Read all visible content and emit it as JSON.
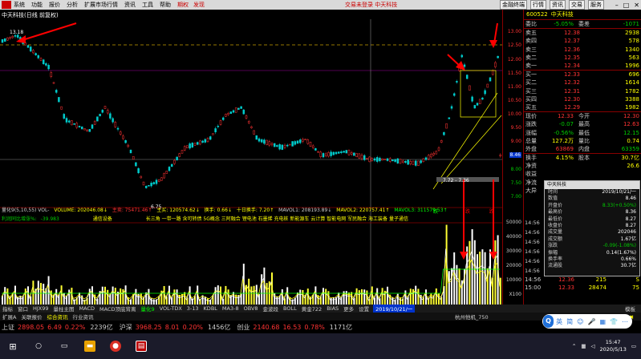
{
  "menubar": {
    "items": [
      "系统",
      "功能",
      "报价",
      "分析",
      "扩展市场行情",
      "资讯",
      "工具",
      "帮助"
    ],
    "red_items": [
      "期权",
      "发现"
    ],
    "center_text": "交易未登录  中天科技",
    "right_buttons": [
      "金融终端",
      "行情",
      "资讯",
      "交易",
      "服务"
    ]
  },
  "chart": {
    "title": "中天科技(日线 前复权)",
    "high_label": "13.18",
    "low_label": "6.75",
    "trend_label": "7.72 - 7.36",
    "axis_labels": [
      "13.00",
      "12.50",
      "12.00",
      "11.50",
      "11.00",
      "10.50",
      "10.00",
      "9.50",
      "9.00",
      "8.50",
      "8.00",
      "7.50",
      "7.00"
    ],
    "current_price_tag": "8.46",
    "vol_axis_labels": [
      "50000",
      "40000",
      "30000",
      "20000",
      "10000",
      "X100"
    ],
    "volume_header": {
      "name": "量化9(5,10,55) VOL-",
      "items": [
        "VOLUME: 202046.08↓",
        "主卖: 75471.46↑",
        "主买: 120574.62↓",
        "换手: 0.66↓",
        "十日换手: 7.20↑",
        "MAVOL1: 208193.89↓",
        "MAVOL2: 220757.41↑",
        "MAVOL3: 311579.53↑"
      ]
    },
    "concept_row": {
      "left": "利润同比增涨%:",
      "left_val": "-39.983",
      "industry": "通信设备",
      "concepts": "长三角 一带一路 含可转债 5G概念 三阿融合 锂电池 石墨烯 充电桩 新能源车 云计算 智能电网 军民融合 海工装备 量子通信"
    },
    "markers": [
      "跌",
      "跌",
      "跌",
      "跌"
    ],
    "date_label": "2019/10/21/一"
  },
  "quote": {
    "code": "600522",
    "name": "中天科技",
    "ratio_row": {
      "l": "委比",
      "a": "-5.05%",
      "l2": "委差",
      "b": "-1071"
    },
    "asks": [
      {
        "l": "卖五",
        "p": "12.38",
        "v": "2938"
      },
      {
        "l": "卖四",
        "p": "12.37",
        "v": "578"
      },
      {
        "l": "卖三",
        "p": "12.36",
        "v": "1340"
      },
      {
        "l": "卖二",
        "p": "12.35",
        "v": "563"
      },
      {
        "l": "卖一",
        "p": "12.34",
        "v": "1996"
      }
    ],
    "bids": [
      {
        "l": "买一",
        "p": "12.33",
        "v": "696"
      },
      {
        "l": "买二",
        "p": "12.32",
        "v": "1614"
      },
      {
        "l": "买三",
        "p": "12.31",
        "v": "1782"
      },
      {
        "l": "买四",
        "p": "12.30",
        "v": "3388"
      },
      {
        "l": "买五",
        "p": "12.29",
        "v": "1982"
      }
    ],
    "stats": [
      {
        "l": "现价",
        "a": "12.33",
        "l2": "今开",
        "b": "12.30"
      },
      {
        "l": "涨跌",
        "a": "-0.07",
        "l2": "最高",
        "b": "12.63"
      },
      {
        "l": "涨幅",
        "a": "-0.56%",
        "l2": "最低",
        "b": "12.15"
      },
      {
        "l": "总量",
        "a": "127.2万",
        "l2": "量比",
        "b": "0.74"
      },
      {
        "l": "外盘",
        "a": "63869",
        "l2": "内盘",
        "b": "63359"
      },
      {
        "l": "换手",
        "a": "4.15%",
        "l2": "股本",
        "b": "30.7亿"
      },
      {
        "l": "净资",
        "a": "",
        "l2": "",
        "b": "26.6"
      },
      {
        "l": "收益",
        "a": "",
        "l2": "",
        "b": ""
      },
      {
        "l": "净流",
        "a": "",
        "l2": "",
        "b": ""
      },
      {
        "l": "大异",
        "a": "",
        "l2": "",
        "b": ""
      }
    ],
    "ticks": [
      "14:56",
      "14:56",
      "14:56",
      "14:56",
      "14:56",
      "14:56",
      "14:56"
    ],
    "bottom_rows": [
      {
        "t": "14:56",
        "p": "12.36",
        "v": "215",
        "s": "S"
      },
      {
        "t": "15:00",
        "p": "12.33",
        "v": "28474",
        "s": "75"
      }
    ]
  },
  "popup": {
    "title": "中天科技",
    "rows": [
      {
        "k": "时间",
        "v": "2019/10/21/一",
        "c": ""
      },
      {
        "k": "数值",
        "v": "8.46",
        "c": ""
      },
      {
        "k": "开盘价",
        "v": "8.33(+0.50%)",
        "c": "g"
      },
      {
        "k": "最高价",
        "v": "8.36",
        "c": ""
      },
      {
        "k": "最低价",
        "v": "8.27",
        "c": ""
      },
      {
        "k": "收盘价",
        "v": "8.27",
        "c": ""
      },
      {
        "k": "成交量",
        "v": "202046",
        "c": ""
      },
      {
        "k": "成交额",
        "v": "1.67亿",
        "c": ""
      },
      {
        "k": "涨跌",
        "v": "-0.09(-1.08%)",
        "c": "g"
      },
      {
        "k": "振幅",
        "v": "0.14(1.67%)",
        "c": ""
      },
      {
        "k": "换手率",
        "v": "0.66%",
        "c": ""
      },
      {
        "k": "流通股",
        "v": "30.7亿",
        "c": ""
      }
    ]
  },
  "ind_tabs": {
    "items": [
      "指标",
      "窗口",
      "HJX99",
      "量柱主图",
      "MACD",
      "MACD顶底背离",
      "量化9",
      "VOL-TDX",
      "3-13",
      "KDBL",
      "MA3-8",
      "OBV8",
      "金波段",
      "BOLL",
      "黄金722",
      "BIAS",
      "更多",
      "设置"
    ],
    "active": "量化9",
    "date": "2019/10/21/一",
    "right": "模板"
  },
  "sub_row": {
    "items": [
      "扩展A",
      "关联报价",
      "综合资讯",
      "行业资讯"
    ],
    "selected": "综合资讯",
    "live": "杭州他机_750",
    "right": "到边栏 ✖"
  },
  "index_strip": [
    {
      "name": "上证",
      "v": "2898.05",
      "c": "6.49",
      "p": "0.22%",
      "amt": "2239亿"
    },
    {
      "name": "沪深",
      "v": "3968.25",
      "c": "8.01",
      "p": "0.20%",
      "amt": "1456亿"
    },
    {
      "name": "创业",
      "v": "2140.68",
      "c": "16.53",
      "p": "0.78%",
      "amt": "1171亿"
    }
  ],
  "ime": {
    "items": [
      "英",
      "简",
      "☺",
      "🎤",
      "▦",
      "👕",
      "⋯"
    ]
  },
  "taskbar": {
    "time": "15:47",
    "date": "2020/5/13"
  },
  "colors": {
    "up": "#ff3333",
    "down": "#00cc00",
    "accent": "#ffff00",
    "grid": "#800000"
  }
}
